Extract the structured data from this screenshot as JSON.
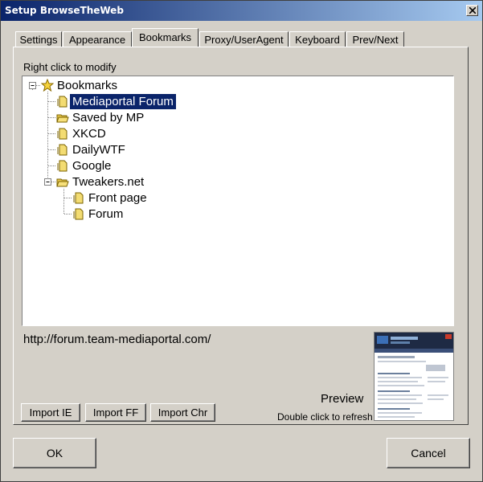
{
  "window": {
    "title": "Setup BrowseTheWeb"
  },
  "tabs": [
    {
      "label": "Settings"
    },
    {
      "label": "Appearance"
    },
    {
      "label": "Bookmarks"
    },
    {
      "label": "Proxy/UserAgent"
    },
    {
      "label": "Keyboard"
    },
    {
      "label": "Prev/Next"
    }
  ],
  "active_tab": "Bookmarks",
  "bookmarks": {
    "hint": "Right click to modify",
    "root": "Bookmarks",
    "items": [
      {
        "label": "Mediaportal Forum",
        "selected": true
      },
      {
        "label": "Saved by MP"
      },
      {
        "label": "XKCD"
      },
      {
        "label": "DailyWTF"
      },
      {
        "label": "Google"
      },
      {
        "label": "Tweakers.net",
        "children": [
          {
            "label": "Front page"
          },
          {
            "label": "Forum"
          }
        ]
      }
    ],
    "url": "http://forum.team-mediaportal.com/"
  },
  "preview": {
    "title": "Preview",
    "hint": "Double click  to refresh"
  },
  "buttons": {
    "import_ie": "Import IE",
    "import_ff": "Import FF",
    "import_chr": "Import Chr",
    "ok": "OK",
    "cancel": "Cancel"
  },
  "colors": {
    "titlebar_start": "#0a246a",
    "titlebar_end": "#a6caf0",
    "selection": "#0a246a",
    "dialog_bg": "#d4d0c8"
  }
}
